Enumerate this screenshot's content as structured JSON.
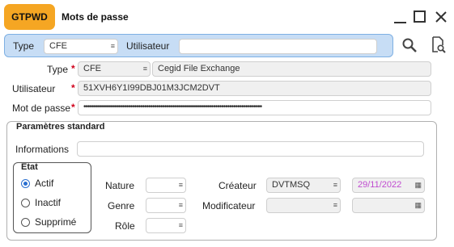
{
  "window": {
    "code_badge": "GTPWD",
    "title": "Mots de passe"
  },
  "filter": {
    "type_label": "Type",
    "type_value": "CFE",
    "user_label": "Utilisateur",
    "user_value": ""
  },
  "form": {
    "type_label": "Type",
    "type_code": "CFE",
    "type_name": "Cegid File Exchange",
    "user_label": "Utilisateur",
    "user_value": "51XVH6Y1I99DBJ01M3JCM2DVT",
    "password_label": "Mot de passe",
    "password_value": "••••••••••••••••••••••••••••••••••••••••••••••••••••••••••••••••••••••••••••••••••••••••",
    "required_mark": "*"
  },
  "standard": {
    "group_title": "Paramètres standard",
    "info_label": "Informations",
    "info_value": "",
    "etat_title": "Etat",
    "etat_options": [
      "Actif",
      "Inactif",
      "Supprimé"
    ],
    "etat_selected": "Actif",
    "nature_label": "Nature",
    "genre_label": "Genre",
    "role_label": "Rôle",
    "createur_label": "Créateur",
    "createur_value": "DVTMSQ",
    "created_date": "29/11/2022",
    "modificateur_label": "Modificateur",
    "modificateur_value": "",
    "modified_date": ""
  },
  "colors": {
    "badge": "#f5a623",
    "filter_bar": "#c7ddf5",
    "required": "#d0021b",
    "date_text": "#c04bd0"
  },
  "icons": [
    "minimize-icon",
    "maximize-icon",
    "close-icon",
    "search-icon",
    "document-search-icon",
    "list-dropdown-icon",
    "calendar-icon"
  ]
}
